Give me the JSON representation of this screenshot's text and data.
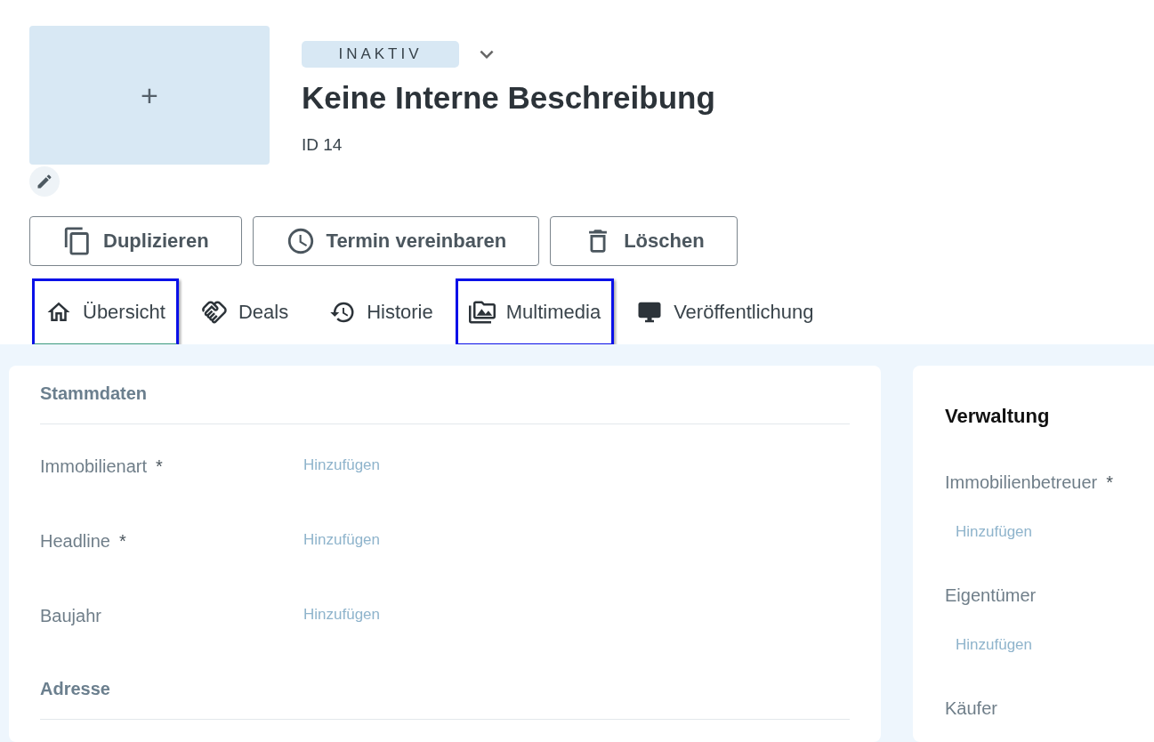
{
  "header": {
    "status": "INAKTIV",
    "title": "Keine Interne Beschreibung",
    "id_text": "ID 14",
    "image_placeholder": "+"
  },
  "actions": [
    {
      "kind": "copy",
      "label": "Duplizieren"
    },
    {
      "kind": "clock",
      "label": "Termin vereinbaren"
    },
    {
      "kind": "delete",
      "label": "Löschen"
    }
  ],
  "tabs": [
    {
      "kind": "home",
      "label": "Übersicht",
      "selected": true,
      "highlighted": true
    },
    {
      "kind": "deals",
      "label": "Deals",
      "selected": false,
      "highlighted": false
    },
    {
      "kind": "history",
      "label": "Historie",
      "selected": false,
      "highlighted": false
    },
    {
      "kind": "media",
      "label": "Multimedia",
      "selected": false,
      "highlighted": true
    },
    {
      "kind": "publish",
      "label": "Veröffentlichung",
      "selected": false,
      "highlighted": false
    }
  ],
  "main_card": {
    "sections": [
      {
        "title": "Stammdaten",
        "fields": [
          {
            "label": "Immobilienart",
            "required_mark": "*",
            "placeholder": "Hinzufügen"
          },
          {
            "label": "Headline",
            "required_mark": "*",
            "placeholder": "Hinzufügen"
          },
          {
            "label": "Baujahr",
            "placeholder": "Hinzufügen"
          }
        ]
      },
      {
        "title": "Adresse"
      }
    ]
  },
  "side_card": {
    "title": "Verwaltung",
    "fields": [
      {
        "label": "Immobilienbetreuer",
        "required_mark": "*",
        "placeholder": "Hinzufügen"
      },
      {
        "label": "Eigentümer",
        "placeholder": "Hinzufügen"
      },
      {
        "label": "Käufer"
      }
    ]
  }
}
